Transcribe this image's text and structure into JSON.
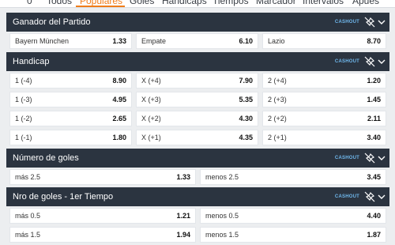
{
  "tabs": [
    "0",
    "Todos",
    "Populares",
    "Goles",
    "Handicaps",
    "Tiempos",
    "Marcador",
    "Intervalos",
    "Apues"
  ],
  "active_tab": "Populares",
  "icons": [
    "pin-off-icon",
    "chevron-down-icon"
  ],
  "colors": {
    "header_bg": "#2b3440",
    "accent": "#f07d1a",
    "cashout": "#6fb7ec"
  },
  "sections": [
    {
      "title": "Ganador del Partido",
      "cashout": "CASHOUT",
      "rows": [
        [
          {
            "label": "Bayern München",
            "odd": "1.33"
          },
          {
            "label": "Empate",
            "odd": "6.10"
          },
          {
            "label": "Lazio",
            "odd": "8.70"
          }
        ]
      ]
    },
    {
      "title": "Handicap",
      "cashout": "CASHOUT",
      "rows": [
        [
          {
            "label": "1 (-4)",
            "odd": "8.90"
          },
          {
            "label": "X (+4)",
            "odd": "7.90"
          },
          {
            "label": "2 (+4)",
            "odd": "1.20"
          }
        ],
        [
          {
            "label": "1 (-3)",
            "odd": "4.95"
          },
          {
            "label": "X (+3)",
            "odd": "5.35"
          },
          {
            "label": "2 (+3)",
            "odd": "1.45"
          }
        ],
        [
          {
            "label": "1 (-2)",
            "odd": "2.65"
          },
          {
            "label": "X (+2)",
            "odd": "4.30"
          },
          {
            "label": "2 (+2)",
            "odd": "2.11"
          }
        ],
        [
          {
            "label": "1 (-1)",
            "odd": "1.80"
          },
          {
            "label": "X (+1)",
            "odd": "4.35"
          },
          {
            "label": "2 (+1)",
            "odd": "3.40"
          }
        ]
      ]
    },
    {
      "title": "Número de goles",
      "cashout": "CASHOUT",
      "rows": [
        [
          {
            "label": "más 2.5",
            "odd": "1.33"
          },
          {
            "label": "menos 2.5",
            "odd": "3.45"
          }
        ]
      ]
    },
    {
      "title": "Nro de goles - 1er Tiempo",
      "cashout": "CASHOUT",
      "rows": [
        [
          {
            "label": "más 0.5",
            "odd": "1.21"
          },
          {
            "label": "menos 0.5",
            "odd": "4.40"
          }
        ],
        [
          {
            "label": "más 1.5",
            "odd": "1.94"
          },
          {
            "label": "menos 1.5",
            "odd": "1.87"
          }
        ]
      ]
    }
  ]
}
